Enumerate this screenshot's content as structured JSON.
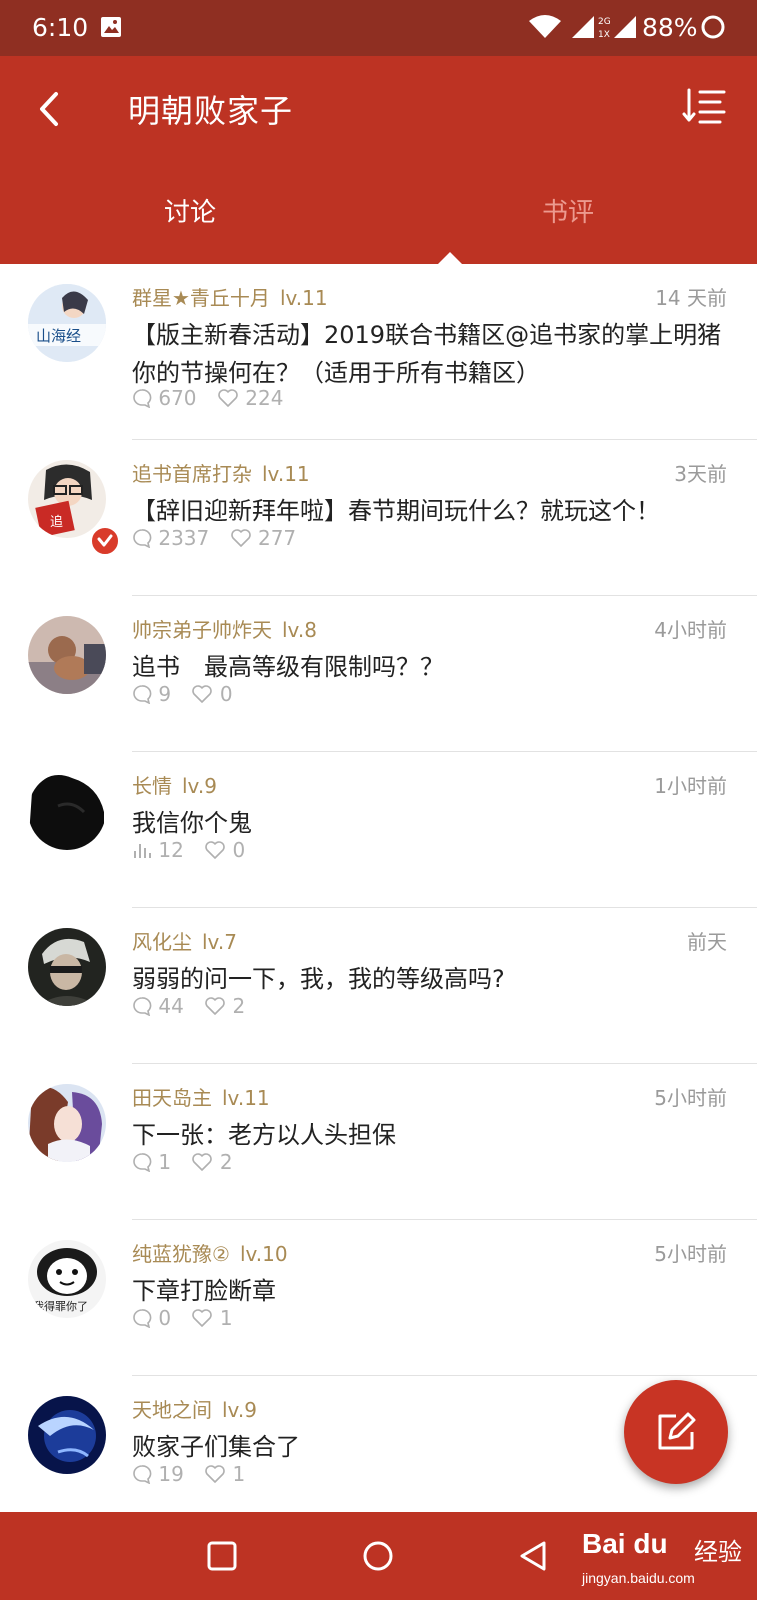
{
  "status_bar": {
    "time": "6:10",
    "network_label_top": "2G",
    "network_label_bottom": "1X",
    "battery": "88%"
  },
  "header": {
    "title": "明朝败家子",
    "tabs": [
      {
        "label": "讨论",
        "active": true
      },
      {
        "label": "书评",
        "active": false
      }
    ]
  },
  "posts": [
    {
      "user": "群星★青丘十月",
      "level": "lv.11",
      "time": "14 天前",
      "title": "【版主新春活动】2019联合书籍区@追书家的掌上明猪 你的节操何在？（适用于所有书籍区）",
      "stat_icon": "comment-icon",
      "comments": "670",
      "likes": "224",
      "verified": false
    },
    {
      "user": "追书首席打杂",
      "level": "lv.11",
      "time": "3天前",
      "title": "【辞旧迎新拜年啦】春节期间玩什么？就玩这个！",
      "stat_icon": "comment-icon",
      "comments": "2337",
      "likes": "277",
      "verified": true
    },
    {
      "user": "帅宗弟子帅炸天",
      "level": "lv.8",
      "time": "4小时前",
      "title": "追书　最高等级有限制吗？？",
      "stat_icon": "comment-icon",
      "comments": "9",
      "likes": "0",
      "verified": false
    },
    {
      "user": "长情",
      "level": "lv.9",
      "time": "1小时前",
      "title": "我信你个鬼",
      "stat_icon": "poll-icon",
      "comments": "12",
      "likes": "0",
      "verified": false
    },
    {
      "user": "风化尘",
      "level": "lv.7",
      "time": "前天",
      "title": "弱弱的问一下，我，我的等级高吗?",
      "stat_icon": "comment-icon",
      "comments": "44",
      "likes": "2",
      "verified": false
    },
    {
      "user": "田天岛主",
      "level": "lv.11",
      "time": "5小时前",
      "title": "下一张：老方以人头担保",
      "stat_icon": "comment-icon",
      "comments": "1",
      "likes": "2",
      "verified": false
    },
    {
      "user": "纯蓝犹豫②",
      "level": "lv.10",
      "time": "5小时前",
      "title": "下章打脸断章",
      "stat_icon": "comment-icon",
      "comments": "0",
      "likes": "1",
      "verified": false
    },
    {
      "user": "天地之间",
      "level": "lv.9",
      "time": "",
      "title": "败家子们集合了",
      "stat_icon": "comment-icon",
      "comments": "19",
      "likes": "1",
      "verified": false
    }
  ],
  "avatar_art": [
    {
      "kind": "text",
      "text": "山海经"
    },
    {
      "kind": "book",
      "text": "追"
    },
    {
      "kind": "photo"
    },
    {
      "kind": "dark"
    },
    {
      "kind": "anime"
    },
    {
      "kind": "anime2"
    },
    {
      "kind": "meme",
      "text": "我得罪你了"
    },
    {
      "kind": "space"
    }
  ],
  "fab": {
    "icon": "compose-icon"
  },
  "watermark": {
    "brand": "Bai du",
    "cn": "经验",
    "url": "jingyan.baidu.com"
  },
  "colors": {
    "status_bar": "#8f2f22",
    "primary": "#bd3323",
    "username": "#a88a54",
    "tab_inactive": "#ec9a8f"
  }
}
